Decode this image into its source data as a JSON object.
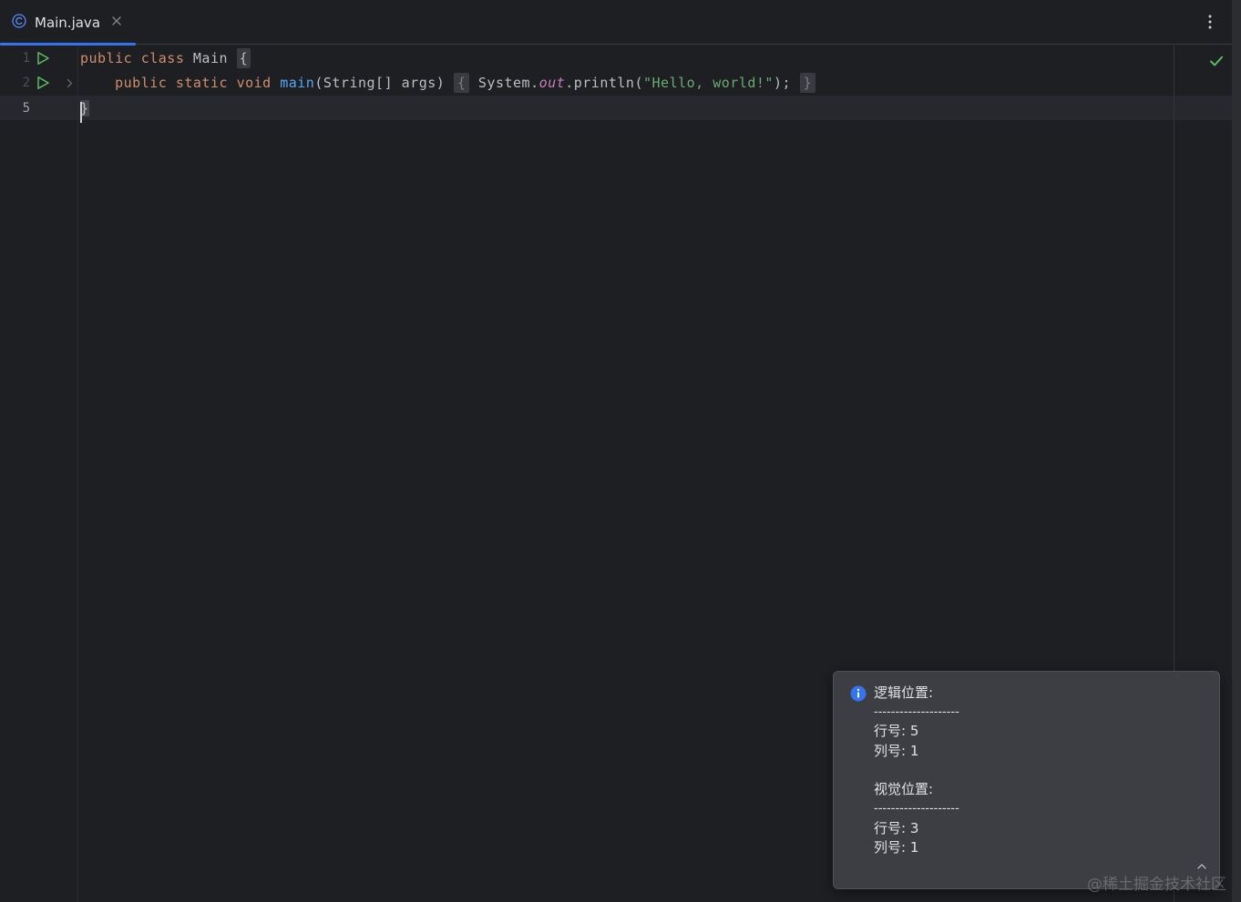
{
  "tab": {
    "title": "Main.java",
    "icon": "class-c-icon",
    "accent": "#3574f0"
  },
  "editor": {
    "lines": [
      {
        "number": "1",
        "segments": [
          {
            "cls": "kw",
            "text": "public "
          },
          {
            "cls": "kw",
            "text": "class "
          },
          {
            "cls": "",
            "text": "Main "
          },
          {
            "cls": "brace",
            "text": "{"
          }
        ]
      },
      {
        "number": "2",
        "segments": [
          {
            "cls": "",
            "text": "    "
          },
          {
            "cls": "kw",
            "text": "public "
          },
          {
            "cls": "kw",
            "text": "static "
          },
          {
            "cls": "kw",
            "text": "void "
          },
          {
            "cls": "fn",
            "text": "main"
          },
          {
            "cls": "",
            "text": "(String[] args)"
          },
          {
            "cls": "fold",
            "text": "{"
          },
          {
            "cls": "",
            "text": " System."
          },
          {
            "cls": "fld",
            "text": "out"
          },
          {
            "cls": "",
            "text": ".println("
          },
          {
            "cls": "str",
            "text": "\"Hello, world!\""
          },
          {
            "cls": "",
            "text": ");"
          },
          {
            "cls": "fold",
            "text": "}"
          }
        ]
      },
      {
        "number": "5",
        "segments": [
          {
            "cls": "caret",
            "text": "}"
          }
        ]
      }
    ],
    "status": "no-problems-check-icon",
    "colors": {
      "keyword": "#cf8e6d",
      "function": "#56a8f5",
      "string": "#6aab73",
      "field": "#c77dbb",
      "text": "#bcbec4",
      "run": "#5fb865"
    }
  },
  "popup": {
    "logical_title": "逻辑位置:",
    "separator1": "--------------------",
    "logical_line": "行号: 5",
    "logical_col": "列号: 1",
    "visual_title": "视觉位置:",
    "separator2": "--------------------",
    "visual_line": "行号: 3",
    "visual_col": "列号: 1"
  },
  "watermark": "@稀土掘金技术社区"
}
